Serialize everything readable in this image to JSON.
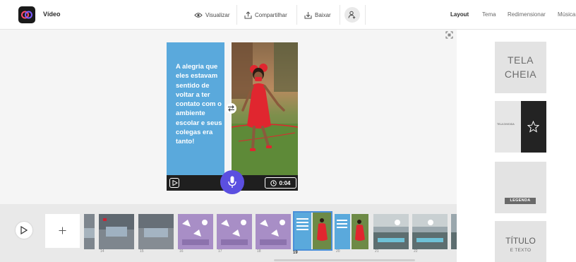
{
  "header": {
    "app_title": "Vídeo",
    "preview_label": "Visualizar",
    "share_label": "Compartilhar",
    "download_label": "Baixar",
    "right_tabs": [
      {
        "label": "Layout",
        "active": true
      },
      {
        "label": "Tema",
        "active": false
      },
      {
        "label": "Redimensionar",
        "active": false
      },
      {
        "label": "Música",
        "active": false
      }
    ]
  },
  "slide": {
    "text": "A alegria que eles estavam sentido de voltar a ter contato com o ambiente escolar e seus colegas era tanto!",
    "duration": "0:04"
  },
  "layouts": {
    "full_screen": "TELA CHEIA",
    "split_screen": "TELA DIVIDIDA",
    "caption": "LEGENDA",
    "title_main": "TÍTULO",
    "title_sub": "E TEXTO"
  },
  "timeline": {
    "slide_numbers": [
      "14",
      "15",
      "16",
      "17",
      "18",
      "19",
      "20",
      "21",
      "22"
    ],
    "active_slide": "19"
  },
  "colors": {
    "accent_purple": "#5b4fe0",
    "slide_blue": "#5aa9dc",
    "dress_red": "#e0262f"
  },
  "icons": {
    "logo": "adobe-express-logo",
    "preview": "eye-icon",
    "share": "share-icon",
    "download": "download-icon",
    "share_user": "share-user-icon",
    "fit": "fit-screen-icon",
    "swap": "swap-icon",
    "mic": "microphone-icon",
    "play": "play-icon",
    "add": "plus-icon",
    "clock": "clock-icon",
    "star": "star-icon"
  }
}
